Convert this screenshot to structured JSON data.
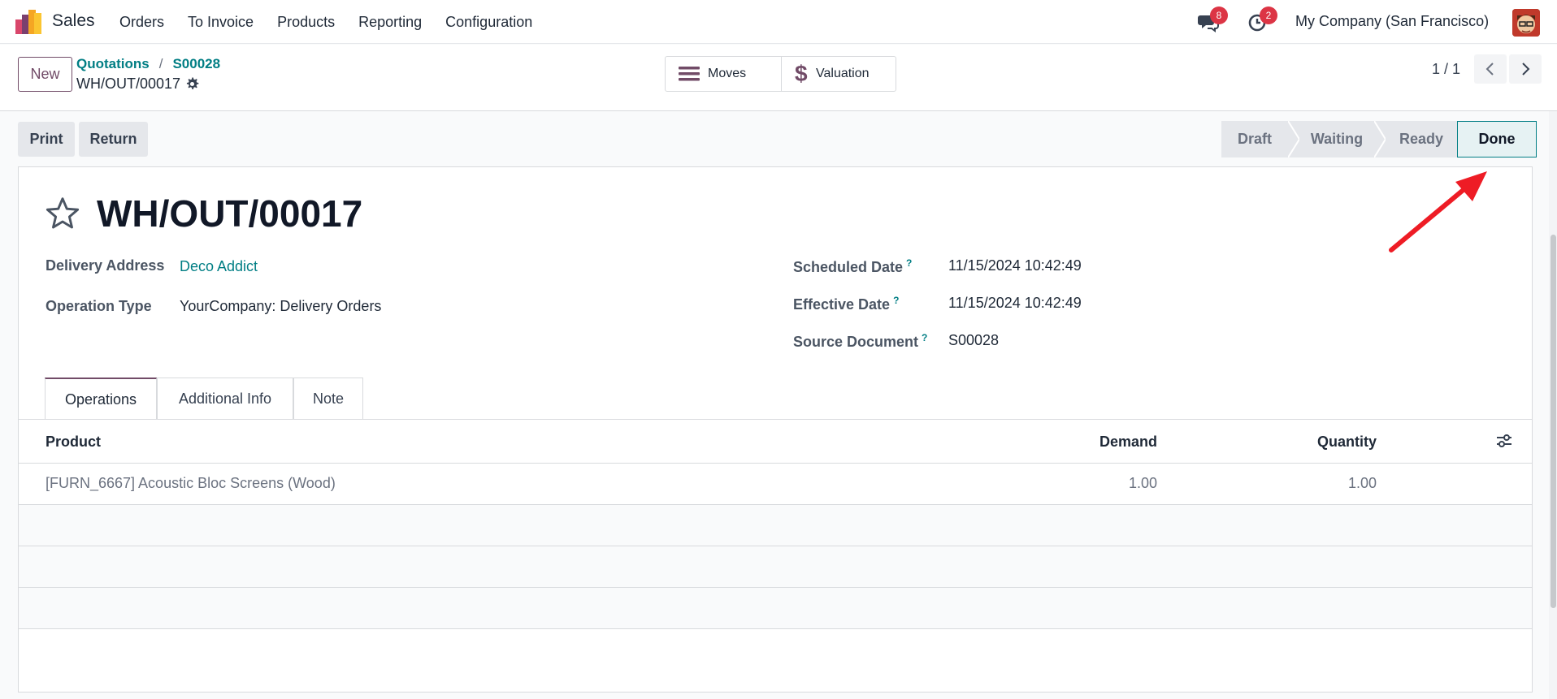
{
  "navbar": {
    "app_name": "Sales",
    "menu": [
      "Orders",
      "To Invoice",
      "Products",
      "Reporting",
      "Configuration"
    ],
    "messages_badge": "8",
    "activities_badge": "2",
    "company": "My Company (San Francisco)"
  },
  "control": {
    "new_label": "New",
    "breadcrumb": [
      "Quotations",
      "S00028"
    ],
    "breadcrumb_sep": "/",
    "record_name": "WH/OUT/00017",
    "smart_buttons": {
      "moves": "Moves",
      "valuation": "Valuation"
    },
    "pager": "1 / 1"
  },
  "statusbar": {
    "print_label": "Print",
    "return_label": "Return",
    "stages": [
      "Draft",
      "Waiting",
      "Ready",
      "Done"
    ],
    "current_stage": "Done"
  },
  "form": {
    "title": "WH/OUT/00017",
    "delivery_address_label": "Delivery Address",
    "delivery_address": "Deco Addict",
    "operation_type_label": "Operation Type",
    "operation_type": "YourCompany: Delivery Orders",
    "scheduled_date_label": "Scheduled Date",
    "scheduled_date": "11/15/2024 10:42:49",
    "effective_date_label": "Effective Date",
    "effective_date": "11/15/2024 10:42:49",
    "source_document_label": "Source Document",
    "source_document": "S00028",
    "help_mark": "?"
  },
  "tabs": [
    "Operations",
    "Additional Info",
    "Note"
  ],
  "table": {
    "columns": [
      "Product",
      "Demand",
      "Quantity"
    ],
    "rows": [
      {
        "product": "[FURN_6667] Acoustic Bloc Screens (Wood)",
        "demand": "1.00",
        "quantity": "1.00"
      }
    ]
  },
  "colors": {
    "brand": "#714b67",
    "link": "#017e84",
    "annotation": "#ee1c25"
  }
}
